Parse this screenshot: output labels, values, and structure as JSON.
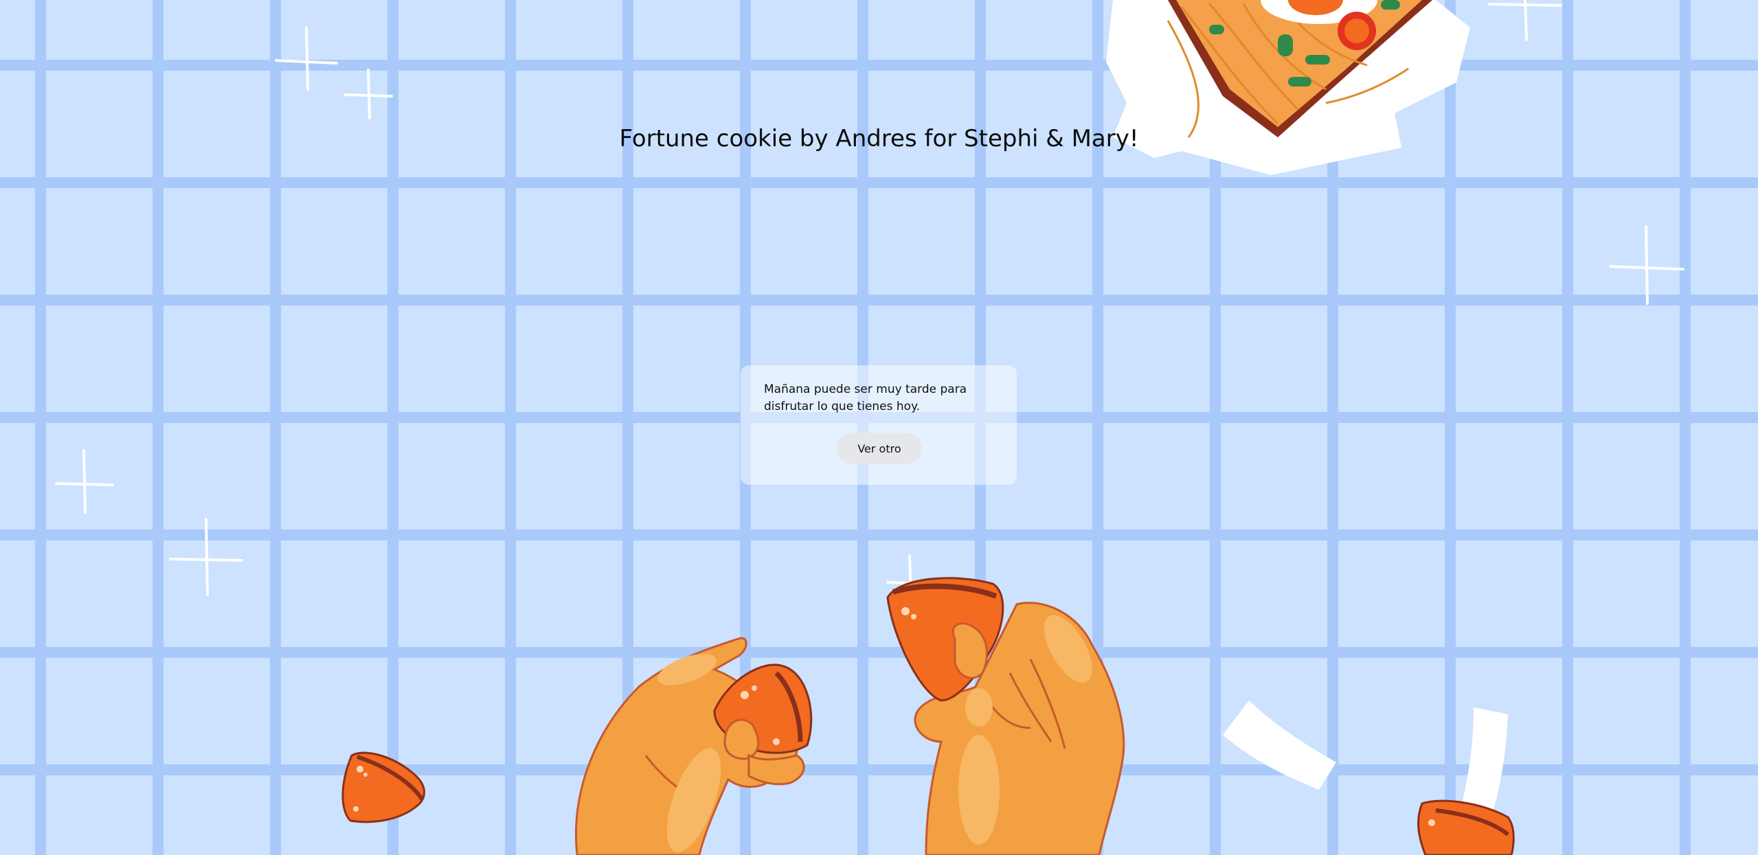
{
  "page": {
    "title": "Fortune cookie by Andres for Stephi & Mary!"
  },
  "fortune": {
    "message": "Mañana puede ser muy tarde para disfrutar lo que tienes hoy.",
    "button_label": "Ver otro"
  },
  "colors": {
    "background": "#cce2fe",
    "grid_lines": "#a9c9fb",
    "cookie_orange": "#f26b21",
    "hand_orange": "#f2a041",
    "card_background": "rgba(255,255,255,0.5)",
    "button_background": "#e5e7eb"
  },
  "decorations": [
    "sparkle-icon",
    "noodle-bowl-icon",
    "hand-icon",
    "fortune-cookie-icon",
    "paper-slip-icon"
  ]
}
